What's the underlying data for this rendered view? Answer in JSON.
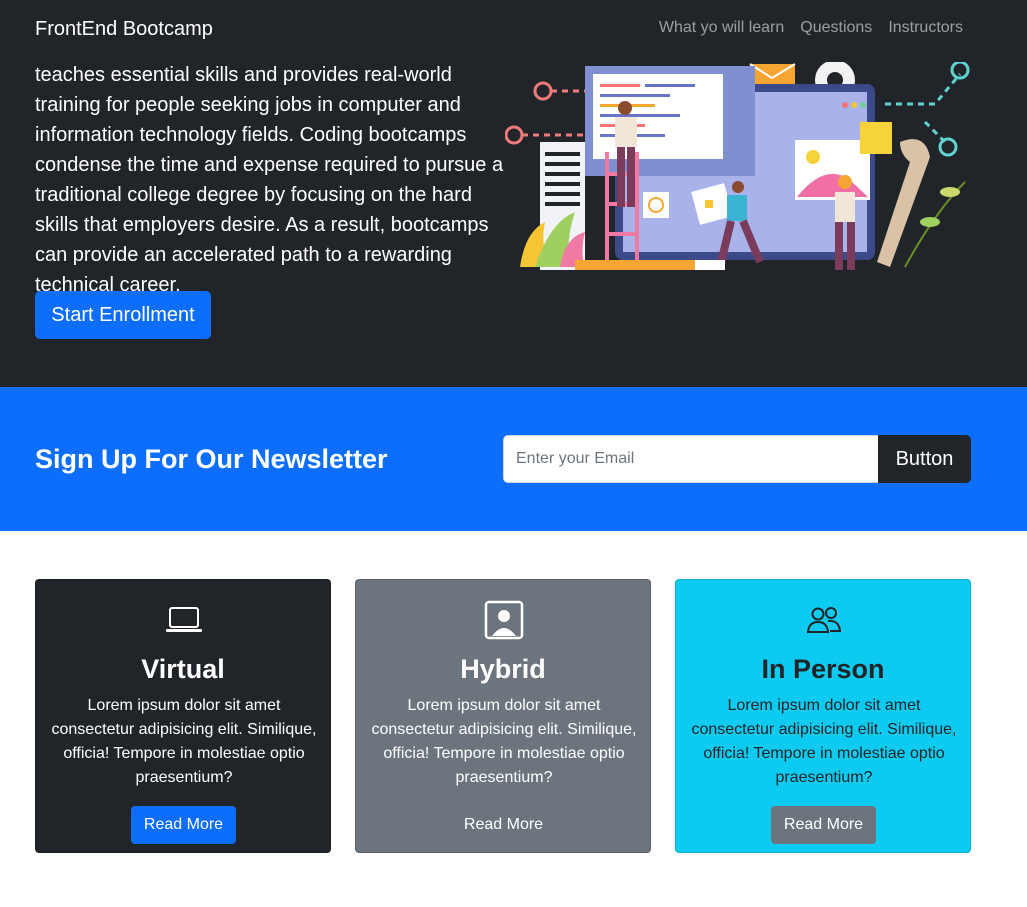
{
  "navbar": {
    "brand": "FrontEnd Bootcamp",
    "links": [
      "What yo will learn",
      "Questions",
      "Instructors"
    ]
  },
  "hero": {
    "text": "teaches essential skills and provides real-world training for people seeking jobs in computer and information technology fields. Coding bootcamps condense the time and expense required to pursue a traditional college degree by focusing on the hard skills that employers desire. As a result, bootcamps can provide an accelerated path to a rewarding technical career.",
    "button_label": "Start Enrollment"
  },
  "newsletter": {
    "title": "Sign Up For Our Newsletter",
    "input_placeholder": "Enter your Email",
    "input_value": "",
    "button_label": "Button"
  },
  "cards": [
    {
      "title": "Virtual",
      "icon": "laptop-icon",
      "text": "Lorem ipsum dolor sit amet consectetur adipisicing elit. Similique, officia! Tempore in molestiae optio praesentium?",
      "button_label": "Read More"
    },
    {
      "title": "Hybrid",
      "icon": "person-square-icon",
      "text": "Lorem ipsum dolor sit amet consectetur adipisicing elit. Similique, officia! Tempore in molestiae optio praesentium?",
      "button_label": "Read More"
    },
    {
      "title": "In Person",
      "icon": "people-icon",
      "text": "Lorem ipsum dolor sit amet consectetur adipisicing elit. Similique, officia! Tempore in molestiae optio praesentium?",
      "button_label": "Read More"
    }
  ],
  "colors": {
    "dark": "#212529",
    "primary": "#0d6efd",
    "secondary": "#6c757d",
    "info": "#0dcaf0"
  }
}
